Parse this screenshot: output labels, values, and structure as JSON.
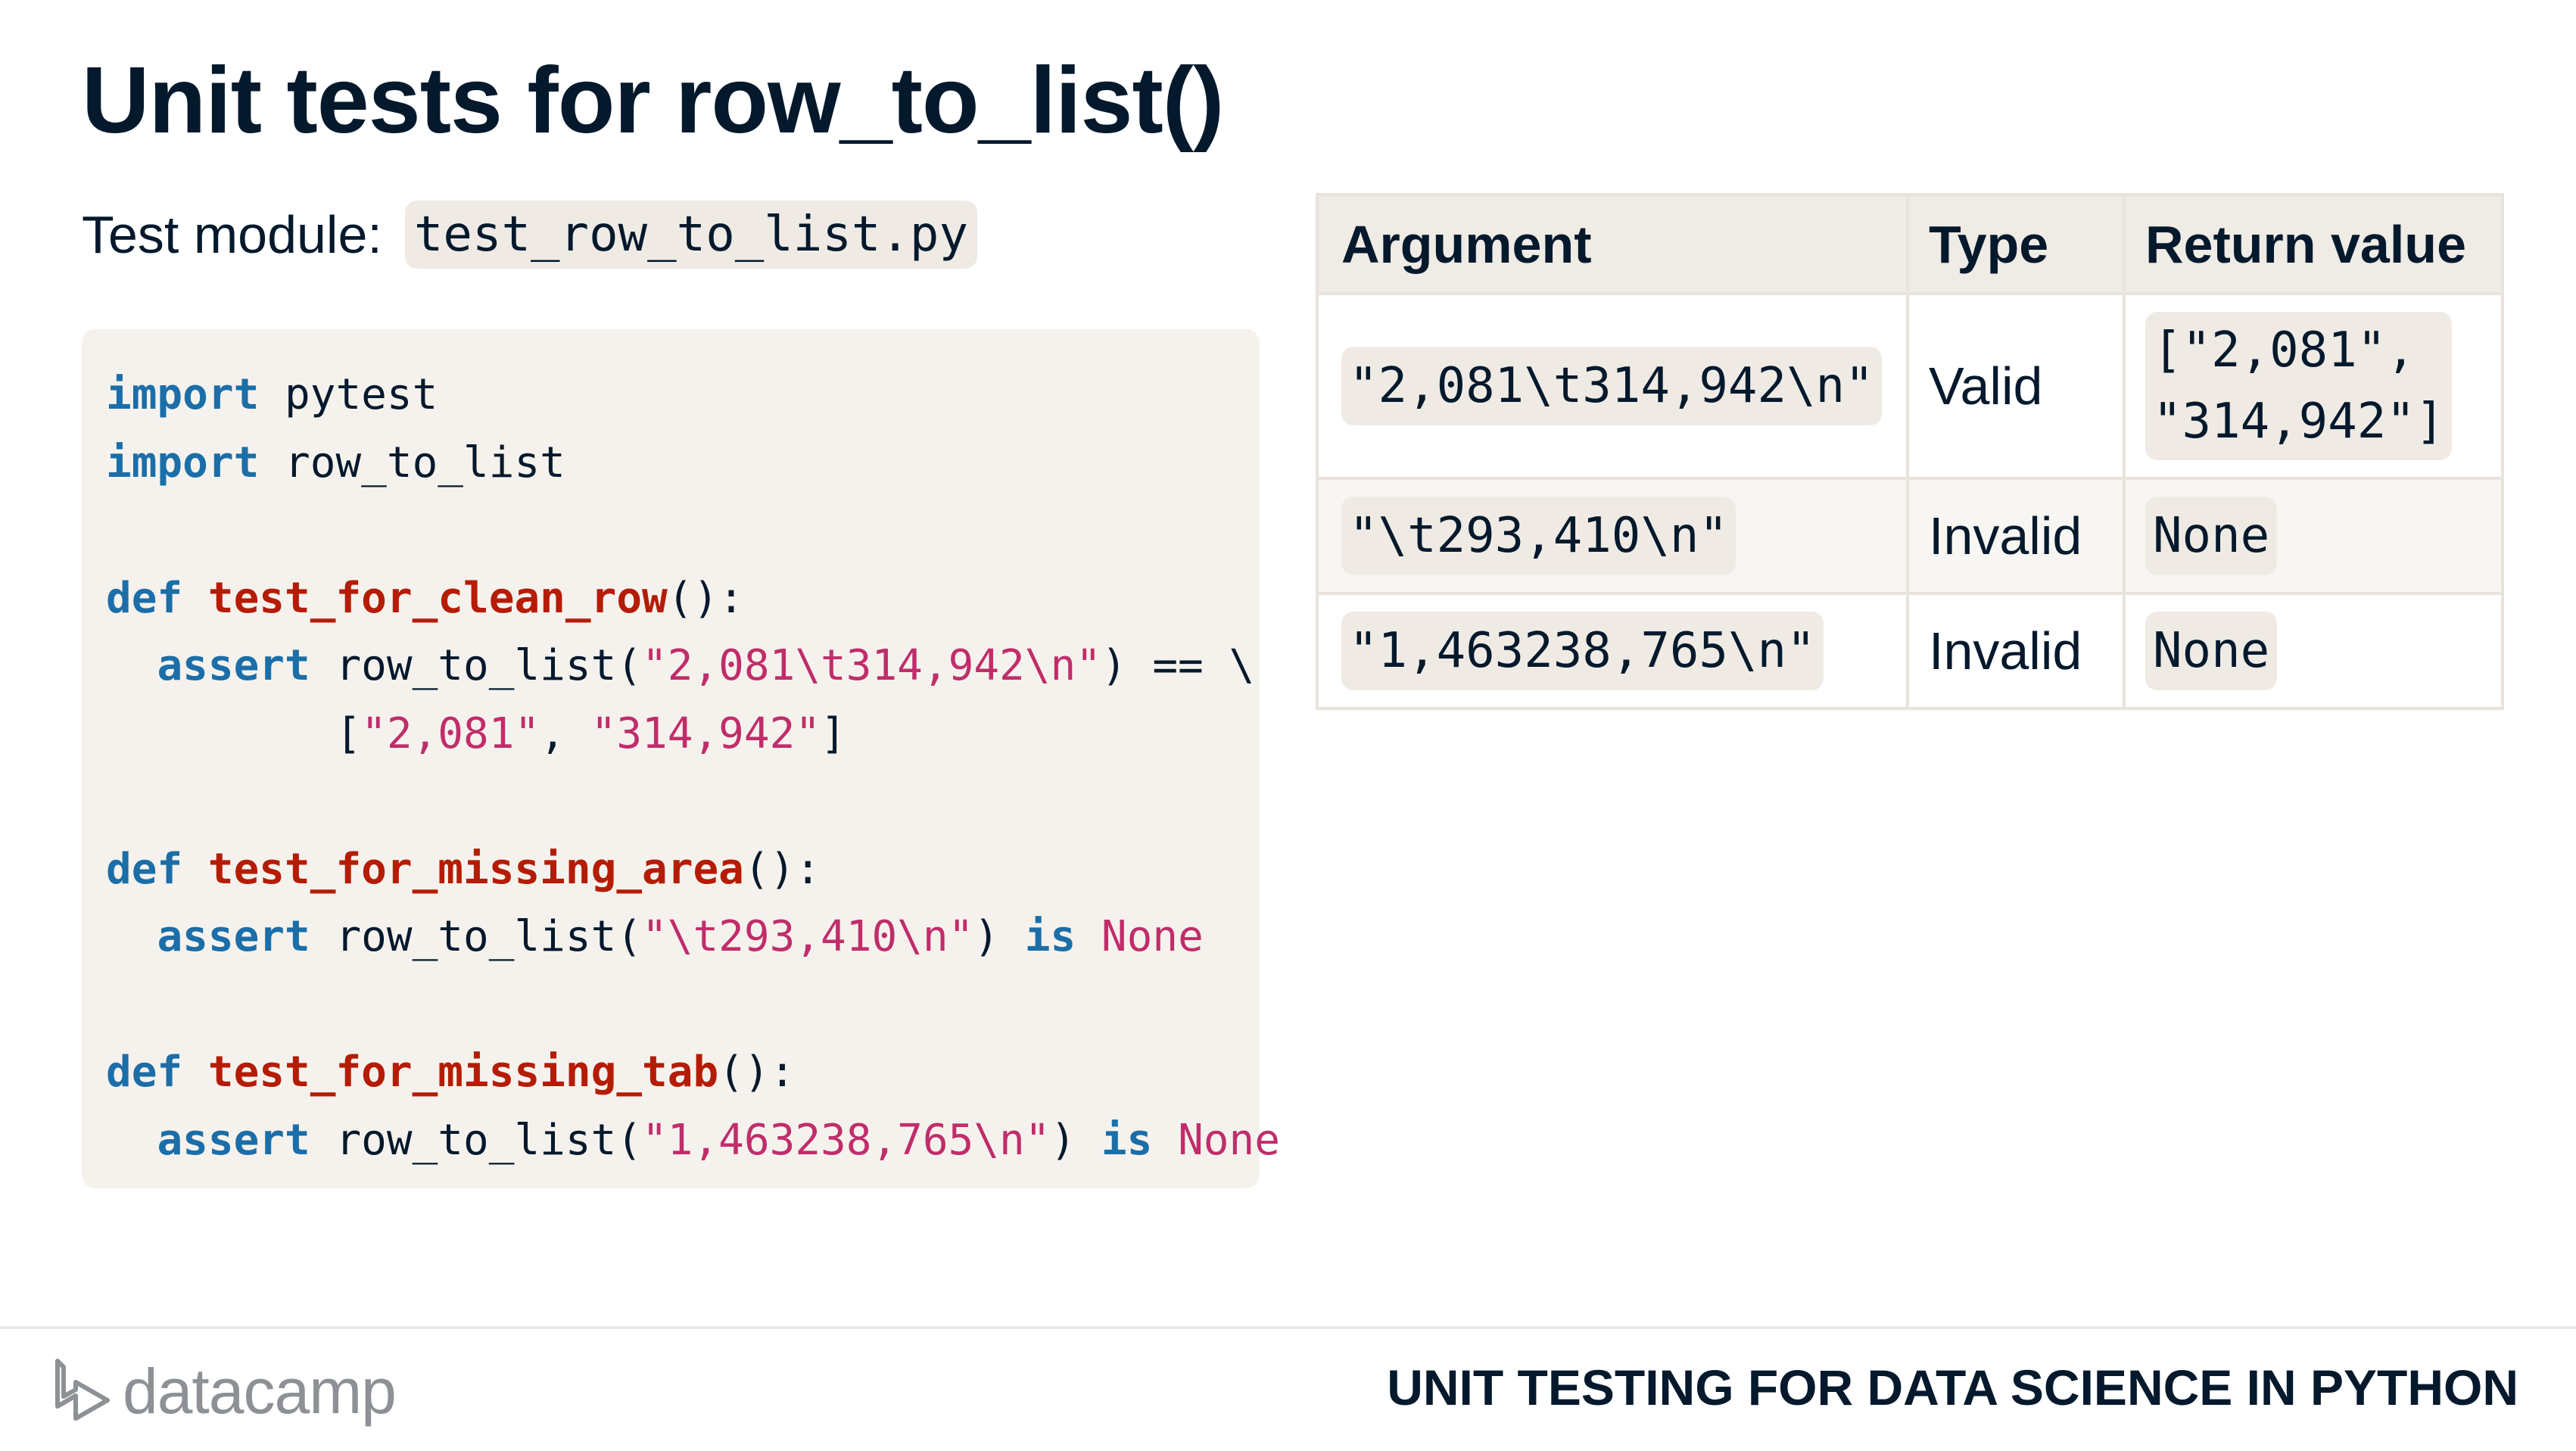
{
  "slide": {
    "title": "Unit tests for row_to_list()",
    "module_label": "Test module:",
    "module_file": "test_row_to_list.py"
  },
  "code": {
    "l1_kw": "import",
    "l1_rest": " pytest",
    "l2_kw": "import",
    "l2_rest": " row_to_list",
    "l4_def": "def",
    "l4_fn": "test_for_clean_row",
    "l4_tail": "():",
    "l5_assert": "assert",
    "l5_call": " row_to_list(",
    "l5_str": "\"2,081\\t314,942\\n\"",
    "l5_tail": ") == \\",
    "l6_open": "[",
    "l6_s1": "\"2,081\"",
    "l6_sep": ", ",
    "l6_s2": "\"314,942\"",
    "l6_close": "]",
    "l8_def": "def",
    "l8_fn": "test_for_missing_area",
    "l8_tail": "():",
    "l9_assert": "assert",
    "l9_call": " row_to_list(",
    "l9_str": "\"\\t293,410\\n\"",
    "l9_close": ") ",
    "l9_is": "is",
    "l9_none": "None",
    "l11_def": "def",
    "l11_fn": "test_for_missing_tab",
    "l11_tail": "():",
    "l12_assert": "assert",
    "l12_call": " row_to_list(",
    "l12_str": "\"1,463238,765\\n\"",
    "l12_close": ") ",
    "l12_is": "is",
    "l12_none": "None"
  },
  "table": {
    "headers": [
      "Argument",
      "Type",
      "Return value"
    ],
    "rows": [
      {
        "argument": "\"2,081\\t314,942\\n\"",
        "type": "Valid",
        "return_value": "[\"2,081\",\n\"314,942\"]"
      },
      {
        "argument": "\"\\t293,410\\n\"",
        "type": "Invalid",
        "return_value": "None"
      },
      {
        "argument": "\"1,463238,765\\n\"",
        "type": "Invalid",
        "return_value": "None"
      }
    ]
  },
  "footer": {
    "logo_text": "datacamp",
    "course_title": "UNIT TESTING FOR DATA SCIENCE IN PYTHON"
  }
}
